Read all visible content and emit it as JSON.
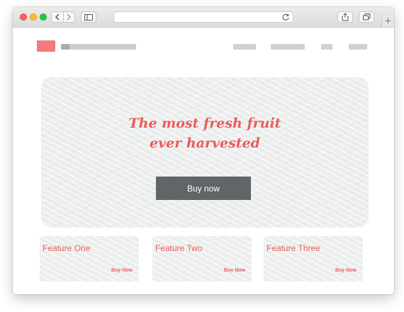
{
  "browser": {
    "url": ""
  },
  "hero": {
    "title_line1": "The most fresh fruit",
    "title_line2": "ever harvested",
    "cta_label": "Buy now"
  },
  "features": [
    {
      "title": "Feature One",
      "link": "Buy Now"
    },
    {
      "title": "Feature Two",
      "link": "Buy Now"
    },
    {
      "title": "Feature Three",
      "link": "Buy Now"
    }
  ],
  "colors": {
    "accent": "#ec5b5b",
    "button": "#616567",
    "placeholder": "#eceeee"
  },
  "icons": {
    "close": "close-dot-icon",
    "minimize": "minimize-dot-icon",
    "maximize": "maximize-dot-icon",
    "back": "chevron-left-icon",
    "forward": "chevron-right-icon",
    "sidebar": "sidebar-icon",
    "reload": "reload-icon",
    "share": "share-icon",
    "tabs": "tabs-icon",
    "new_tab": "plus-icon"
  }
}
